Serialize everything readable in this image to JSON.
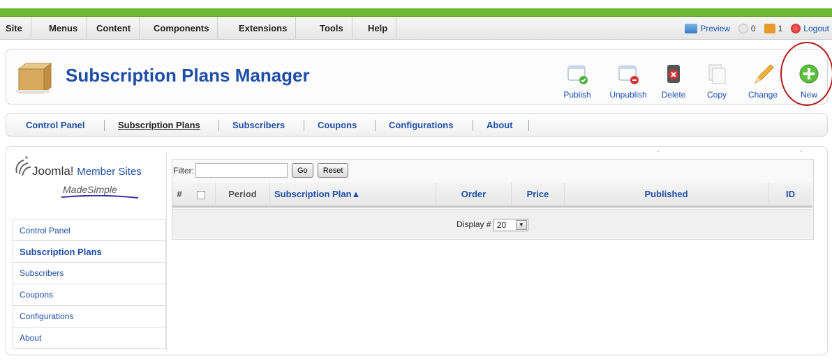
{
  "menubar": {
    "items": [
      "Site",
      "Menus",
      "Content",
      "Components",
      "Extensions",
      "Tools",
      "Help"
    ],
    "status": {
      "preview_label": "Preview",
      "messages_count": "0",
      "users_count": "1",
      "logout_label": "Logout"
    }
  },
  "header": {
    "title": "Subscription Plans Manager",
    "toolbar": [
      {
        "label": "Publish",
        "icon": "publish-icon"
      },
      {
        "label": "Unpublish",
        "icon": "unpublish-icon"
      },
      {
        "label": "Delete",
        "icon": "delete-icon"
      },
      {
        "label": "Copy",
        "icon": "copy-icon"
      },
      {
        "label": "Change",
        "icon": "pencil-icon"
      },
      {
        "label": "New",
        "icon": "add-icon"
      }
    ]
  },
  "submenu": {
    "tabs": [
      "Control Panel",
      "Subscription Plans",
      "Subscribers",
      "Coupons",
      "Configurations",
      "About"
    ],
    "active": "Subscription Plans"
  },
  "sidebar": {
    "logo": {
      "brand": "Joomla!",
      "brand2": "Member Sites",
      "tagline": "MadeSimple"
    },
    "items": [
      "Control Panel",
      "Subscription Plans",
      "Subscribers",
      "Coupons",
      "Configurations",
      "About"
    ],
    "active": "Subscription Plans"
  },
  "grid": {
    "filter_label": "Filter:",
    "filter_value": "",
    "go_label": "Go",
    "reset_label": "Reset",
    "columns": [
      "#",
      "",
      "Period",
      "Subscription Plan▲",
      "Order",
      "Price",
      "Published",
      "ID"
    ],
    "footer": {
      "display_label": "Display #",
      "display_value": "20"
    }
  },
  "colors": {
    "accent": "#1e4ea6",
    "topstrip": "#6fb935",
    "highlight": "#b31a1a"
  }
}
